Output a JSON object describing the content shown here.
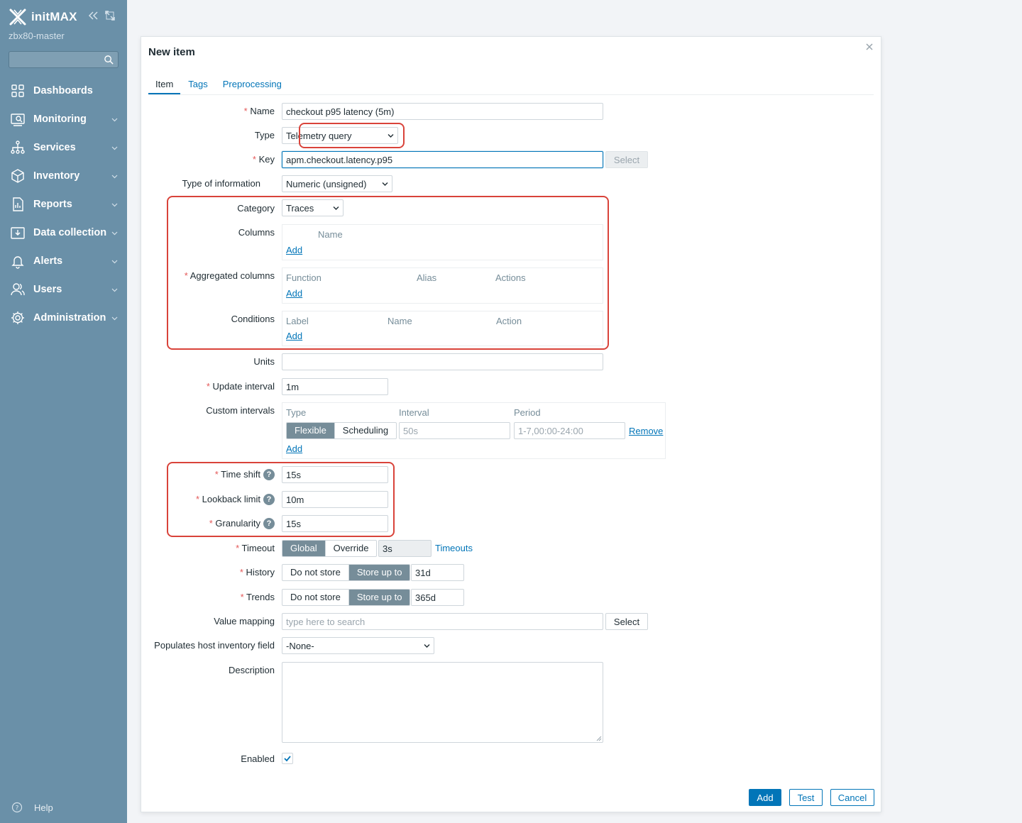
{
  "sidebar": {
    "brand": "initMAX",
    "server": "zbx80-master",
    "search_placeholder": "",
    "items": [
      {
        "label": "Dashboards",
        "icon": "dashboards-icon"
      },
      {
        "label": "Monitoring",
        "icon": "monitoring-icon"
      },
      {
        "label": "Services",
        "icon": "services-icon"
      },
      {
        "label": "Inventory",
        "icon": "inventory-icon"
      },
      {
        "label": "Reports",
        "icon": "reports-icon"
      },
      {
        "label": "Data collection",
        "icon": "data-collection-icon"
      },
      {
        "label": "Alerts",
        "icon": "alerts-icon"
      },
      {
        "label": "Users",
        "icon": "users-icon"
      },
      {
        "label": "Administration",
        "icon": "administration-icon"
      }
    ],
    "help": "Help"
  },
  "dialog": {
    "title": "New item",
    "tabs": [
      "Item",
      "Tags",
      "Preprocessing"
    ],
    "active_tab": "Item",
    "fields": {
      "name": {
        "label": "Name",
        "value": "checkout p95 latency (5m)"
      },
      "type": {
        "label": "Type",
        "value": "Telemetry query"
      },
      "key": {
        "label": "Key",
        "value": "apm.checkout.latency.p95",
        "button": "Select"
      },
      "type_of_information": {
        "label": "Type of information",
        "value": "Numeric (unsigned)"
      },
      "category": {
        "label": "Category",
        "value": "Traces"
      },
      "columns": {
        "label": "Columns",
        "headers": [
          "Name"
        ],
        "add": "Add"
      },
      "aggregated_columns": {
        "label": "Aggregated columns",
        "headers": [
          "Function",
          "Alias",
          "Actions"
        ],
        "add": "Add"
      },
      "conditions": {
        "label": "Conditions",
        "headers": [
          "Label",
          "Name",
          "Action"
        ],
        "add": "Add"
      },
      "units": {
        "label": "Units",
        "value": ""
      },
      "update_interval": {
        "label": "Update interval",
        "value": "1m"
      },
      "custom_intervals": {
        "label": "Custom intervals",
        "headers": [
          "Type",
          "Interval",
          "Period"
        ],
        "type_options": [
          "Flexible",
          "Scheduling"
        ],
        "type_selected": "Flexible",
        "interval_placeholder": "50s",
        "period_placeholder": "1-7,00:00-24:00",
        "remove": "Remove",
        "add": "Add"
      },
      "time_shift": {
        "label": "Time shift",
        "value": "15s"
      },
      "lookback_limit": {
        "label": "Lookback limit",
        "value": "10m"
      },
      "granularity": {
        "label": "Granularity",
        "value": "15s"
      },
      "timeout": {
        "label": "Timeout",
        "options": [
          "Global",
          "Override"
        ],
        "selected": "Global",
        "value": "3s",
        "link": "Timeouts"
      },
      "history": {
        "label": "History",
        "options": [
          "Do not store",
          "Store up to"
        ],
        "selected": "Store up to",
        "value": "31d"
      },
      "trends": {
        "label": "Trends",
        "options": [
          "Do not store",
          "Store up to"
        ],
        "selected": "Store up to",
        "value": "365d"
      },
      "value_mapping": {
        "label": "Value mapping",
        "placeholder": "type here to search",
        "button": "Select"
      },
      "inventory_field": {
        "label": "Populates host inventory field",
        "value": "-None-"
      },
      "description": {
        "label": "Description",
        "value": ""
      },
      "enabled": {
        "label": "Enabled",
        "checked": true
      }
    },
    "buttons": {
      "add": "Add",
      "test": "Test",
      "cancel": "Cancel"
    }
  },
  "colors": {
    "sidebar": "#6a90a8",
    "accent": "#0275b8",
    "required": "#e45959",
    "highlight": "#d9433a",
    "segment_on": "#768d99"
  }
}
